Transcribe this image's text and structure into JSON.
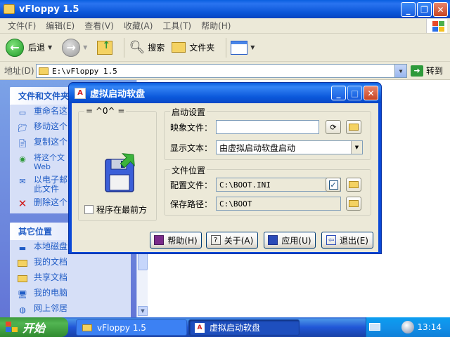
{
  "explorer": {
    "title": "vFloppy 1.5",
    "menu": [
      "文件(F)",
      "编辑(E)",
      "查看(V)",
      "收藏(A)",
      "工具(T)",
      "帮助(H)"
    ],
    "toolbar": {
      "back": "后退",
      "search": "搜索",
      "folders": "文件夹"
    },
    "address_label": "地址(D)",
    "address_value": "E:\\vFloppy 1.5",
    "go_label": "转到",
    "tasks_panel": {
      "title": "文件和文件夹",
      "items": [
        "重命名这",
        "移动这个",
        "复制这个",
        "将这个文\nWeb",
        "以电子邮\n此文件",
        "删除这个"
      ]
    },
    "other_panel": {
      "title": "其它位置",
      "items": [
        "本地磁盘",
        "我的文档",
        "共享文档",
        "我的电脑",
        "网上邻居"
      ]
    }
  },
  "dialog": {
    "title": "虚拟启动软盘",
    "left_group_label": "= ^0^ =",
    "topmost_label": "程序在最前方",
    "topmost_checked": false,
    "boot_group": {
      "label": "启动设置",
      "image_label": "映象文件：",
      "image_value": "",
      "display_label": "显示文本：",
      "display_value": "由虚拟启动软盘启动"
    },
    "file_group": {
      "label": "文件位置",
      "config_label": "配置文件：",
      "config_value": "C:\\BOOT.INI",
      "save_label": "保存路径：",
      "save_value": "C:\\BOOT"
    },
    "buttons": {
      "help": "帮助(H)",
      "about": "关于(A)",
      "apply": "应用(U)",
      "exit": "退出(E)"
    }
  },
  "taskbar": {
    "start": "开始",
    "items": [
      "vFloppy 1.5",
      "虚拟启动软盘"
    ],
    "clock": "13:14"
  }
}
